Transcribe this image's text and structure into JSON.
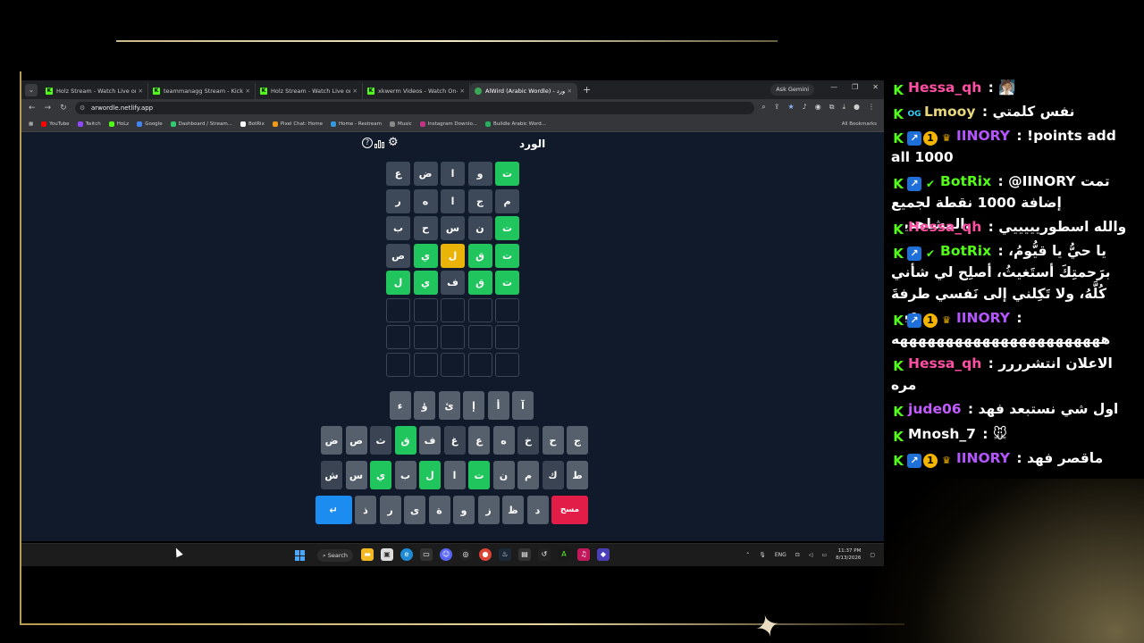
{
  "browser": {
    "tabs": [
      {
        "title": "Holz Stream - Watch Live on Ki",
        "active": false
      },
      {
        "title": "teammanagg Stream - Kick Da",
        "active": false
      },
      {
        "title": "Holz Stream - Watch Live on Ki",
        "active": false
      },
      {
        "title": "xkwerm Videos - Watch On-De",
        "active": false
      },
      {
        "title": "AlWird (Arabic Wordle) - الورد",
        "active": true
      }
    ],
    "new_tab": "+",
    "ask_gemini": "Ask Gemini",
    "url": "arwordle.netlify.app",
    "bookmarks": [
      "YouTube",
      "Twitch",
      "HoLz",
      "Google",
      "Dashboard / Stream...",
      "BotRix",
      "Pixel Chat: Home",
      "Home - Restream",
      "Music",
      "Instagram Downlo...",
      "Buildle Arabic Word..."
    ],
    "all_bookmarks": "All Bookmarks"
  },
  "game": {
    "title": "الورد",
    "grid": [
      [
        [
          "ت",
          "g"
        ],
        [
          "و",
          "x"
        ],
        [
          "ا",
          "x"
        ],
        [
          "ض",
          "x"
        ],
        [
          "ع",
          "x"
        ]
      ],
      [
        [
          "م",
          "x"
        ],
        [
          "ج",
          "x"
        ],
        [
          "ا",
          "x"
        ],
        [
          "ه",
          "x"
        ],
        [
          "ر",
          "x"
        ]
      ],
      [
        [
          "ت",
          "g"
        ],
        [
          "ن",
          "x"
        ],
        [
          "س",
          "x"
        ],
        [
          "ح",
          "x"
        ],
        [
          "ب",
          "x"
        ]
      ],
      [
        [
          "ت",
          "g"
        ],
        [
          "ق",
          "g"
        ],
        [
          "ل",
          "y"
        ],
        [
          "ي",
          "g"
        ],
        [
          "ص",
          "x"
        ]
      ],
      [
        [
          "ت",
          "g"
        ],
        [
          "ق",
          "g"
        ],
        [
          "ف",
          "x"
        ],
        [
          "ي",
          "g"
        ],
        [
          "ل",
          "g"
        ]
      ],
      [
        [
          "",
          ""
        ],
        [
          "",
          ""
        ],
        [
          "",
          ""
        ],
        [
          "",
          ""
        ],
        [
          "",
          ""
        ]
      ],
      [
        [
          "",
          ""
        ],
        [
          "",
          ""
        ],
        [
          "",
          ""
        ],
        [
          "",
          ""
        ],
        [
          "",
          ""
        ]
      ],
      [
        [
          "",
          ""
        ],
        [
          "",
          ""
        ],
        [
          "",
          ""
        ],
        [
          "",
          ""
        ],
        [
          "",
          ""
        ]
      ]
    ],
    "keyboard": {
      "row1": [
        [
          "آ",
          ""
        ],
        [
          "أ",
          ""
        ],
        [
          "إ",
          ""
        ],
        [
          "ئ",
          ""
        ],
        [
          "ؤ",
          ""
        ],
        [
          "ء",
          ""
        ]
      ],
      "row2": [
        [
          "ج",
          ""
        ],
        [
          "ح",
          ""
        ],
        [
          "خ",
          "x"
        ],
        [
          "ه",
          ""
        ],
        [
          "ع",
          ""
        ],
        [
          "غ",
          "x"
        ],
        [
          "ف",
          ""
        ],
        [
          "ق",
          "g"
        ],
        [
          "ث",
          "x"
        ],
        [
          "ص",
          ""
        ],
        [
          "ض",
          ""
        ]
      ],
      "row3": [
        [
          "ط",
          ""
        ],
        [
          "ك",
          "x"
        ],
        [
          "م",
          ""
        ],
        [
          "ن",
          ""
        ],
        [
          "ت",
          "g"
        ],
        [
          "ا",
          ""
        ],
        [
          "ل",
          "g"
        ],
        [
          "ب",
          ""
        ],
        [
          "ي",
          "g"
        ],
        [
          "س",
          ""
        ],
        [
          "ش",
          "x"
        ]
      ],
      "row4": [
        [
          "مسح",
          "del"
        ],
        [
          "د",
          ""
        ],
        [
          "ظ",
          ""
        ],
        [
          "ز",
          ""
        ],
        [
          "و",
          ""
        ],
        [
          "ة",
          ""
        ],
        [
          "ى",
          ""
        ],
        [
          "ر",
          ""
        ],
        [
          "ذ",
          ""
        ],
        [
          "↵",
          "enter"
        ]
      ]
    }
  },
  "taskbar": {
    "search": "Search",
    "lang": "ENG",
    "time": "11:37 PM",
    "date": "8/13/2026"
  },
  "chat": [
    {
      "user": "Hessa_qh",
      "color": "#ff4fa3",
      "badges": [
        "kick"
      ],
      "sep": " : ",
      "text": "🧖🏽"
    },
    {
      "user": "Lmooy",
      "color": "#e8d87a",
      "badges": [
        "kick",
        "og"
      ],
      "sep": " : ",
      "text": "نفس كلمتي"
    },
    {
      "user": "IINORY",
      "color": "#b455ff",
      "badges": [
        "kick",
        "vip",
        "one",
        "crown"
      ],
      "sep": " : ",
      "text": "!points add all 1000"
    },
    {
      "user": "BotRix",
      "color": "#53fc18",
      "badges": [
        "kick",
        "vip",
        "check"
      ],
      "sep": " : ",
      "text": "@IINORY تمت إضافة 1000 نقطة لجميع المشاهدين."
    },
    {
      "user": "Hessa_qh",
      "color": "#ff4fa3",
      "badges": [
        "kick"
      ],
      "sep": " : ",
      "text": "والله اسطوريييييي"
    },
    {
      "user": "BotRix",
      "color": "#53fc18",
      "badges": [
        "kick",
        "vip",
        "check"
      ],
      "sep": " : ",
      "text": "يا حيُّ يا قيُّومُ، برَحمتِكَ أستَغيثُ، أصلِح لي شأني كُلَّهُ، ولا تَكِلني إلى نَفسي طرفةَ عينٍ"
    },
    {
      "user": "IINORY",
      "color": "#b455ff",
      "badges": [
        "kick",
        "vip",
        "one",
        "crown"
      ],
      "sep": " : ",
      "text": "هههههههههههههههههههههههه"
    },
    {
      "user": "Hessa_qh",
      "color": "#ff4fa3",
      "badges": [
        "kick"
      ],
      "sep": " : ",
      "text": "الاعلان انتشرررر مره"
    },
    {
      "user": "jude06",
      "color": "#c45bff",
      "badges": [
        "kick"
      ],
      "sep": " : ",
      "text": "اول شي نستبعد فهد"
    },
    {
      "user": "Mnosh_7",
      "color": "#ffffff",
      "badges": [
        "kick"
      ],
      "sep": " : ",
      "text": "🐭"
    },
    {
      "user": "IINORY",
      "color": "#b455ff",
      "badges": [
        "kick",
        "vip",
        "one",
        "crown"
      ],
      "sep": " : ",
      "text": "ماقصر فهد"
    }
  ]
}
